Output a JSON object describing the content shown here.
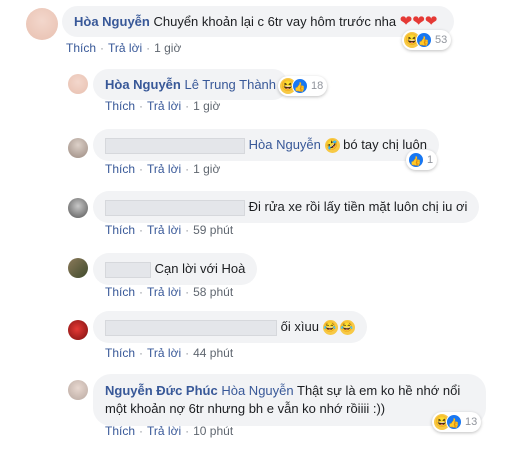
{
  "actions": {
    "like": "Thích",
    "reply": "Trả lời",
    "sep": "·"
  },
  "comments": [
    {
      "name": "Hòa Nguyễn",
      "text": "Chuyển khoản lại c 6tr vay hôm trước nha",
      "time": "1 giờ",
      "reactions": "53"
    },
    {
      "name": "Hòa Nguyễn",
      "tag": "Lê Trung Thành",
      "time": "1 giờ",
      "reactions": "18"
    },
    {
      "tag": "Hòa Nguyễn",
      "text": "bó tay chị luôn",
      "time": "1 giờ",
      "reactions": "1"
    },
    {
      "text": "Đi rửa xe rồi lấy tiền mặt luôn chị iu ơi",
      "time": "59 phút"
    },
    {
      "text": "Cạn lời với Hoà",
      "time": "58 phút"
    },
    {
      "text": "ối xìuu",
      "time": "44 phút"
    },
    {
      "name": "Nguyễn Đức Phúc",
      "tag": "Hòa Nguyễn",
      "text": "Thật sự là em ko hề nhớ nổi một khoản nợ 6tr nhưng bh e vẫn ko nhớ rồiiii :))",
      "time": "10 phút",
      "reactions": "13"
    }
  ]
}
